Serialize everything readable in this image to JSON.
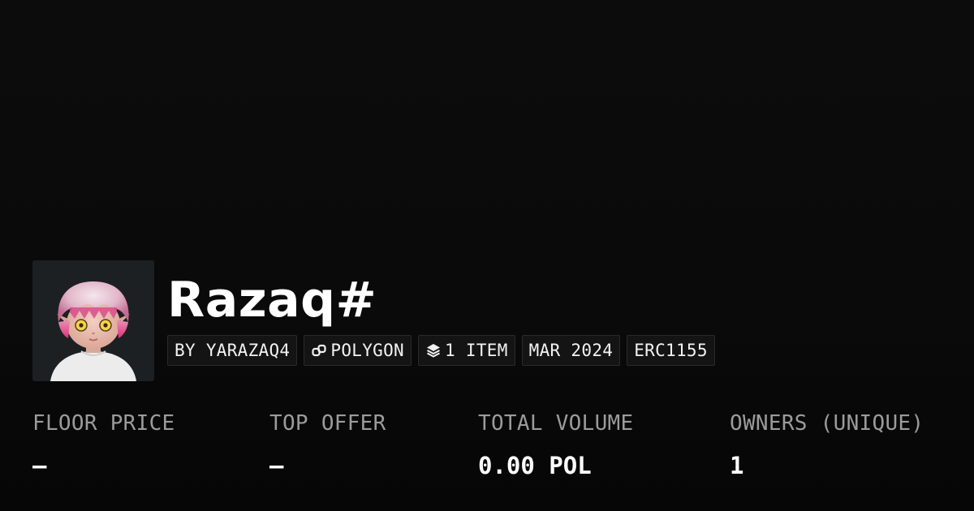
{
  "collection": {
    "title": "Razaq#",
    "avatar_alt": "collection-avatar"
  },
  "tags": [
    {
      "label": "BY YARAZAQ4",
      "icon": ""
    },
    {
      "label": "POLYGON",
      "icon": "chain-link-icon"
    },
    {
      "label": "1 ITEM",
      "icon": "layers-icon"
    },
    {
      "label": "MAR 2024",
      "icon": ""
    },
    {
      "label": "ERC1155",
      "icon": ""
    }
  ],
  "stats": [
    {
      "label": "FLOOR PRICE",
      "value": "–"
    },
    {
      "label": "TOP OFFER",
      "value": "–"
    },
    {
      "label": "TOTAL VOLUME",
      "value": "0.00 POL"
    },
    {
      "label": "OWNERS (UNIQUE)",
      "value": "1"
    }
  ],
  "colors": {
    "background": "#0b0b0b",
    "tag_background": "#141414",
    "label_gray": "#9b9b9b"
  }
}
